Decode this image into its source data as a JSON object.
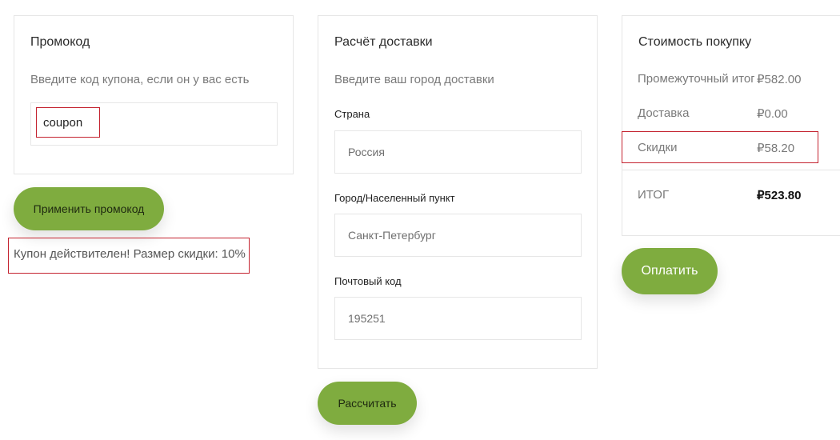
{
  "promo": {
    "title": "Промокод",
    "hint": "Введите код купона, если он у вас есть",
    "coupon_value": "coupon",
    "apply_button": "Применить промокод",
    "success_message": "Купон действителен! Размер скидки: 10%"
  },
  "shipping": {
    "title": "Расчёт доставки",
    "hint": "Введите ваш город доставки",
    "country_label": "Страна",
    "country_value": "Россия",
    "city_label": "Город/Населенный пункт",
    "city_value": "Санкт-Петербург",
    "zip_label": "Почтовый код",
    "zip_value": "195251",
    "calculate_button": "Рассчитать"
  },
  "totals": {
    "title": "Стоимость покупку",
    "rows": [
      {
        "label": "Промежуточный итог",
        "value": "₽582.00"
      },
      {
        "label": "Доставка",
        "value": "₽0.00"
      },
      {
        "label": "Скидки",
        "value": "₽58.20"
      },
      {
        "label": "ИТОГ",
        "value": "₽523.80"
      }
    ],
    "pay_button": "Оплатить"
  },
  "colors": {
    "accent": "#7fac3f",
    "highlight_border": "#c4232f"
  }
}
